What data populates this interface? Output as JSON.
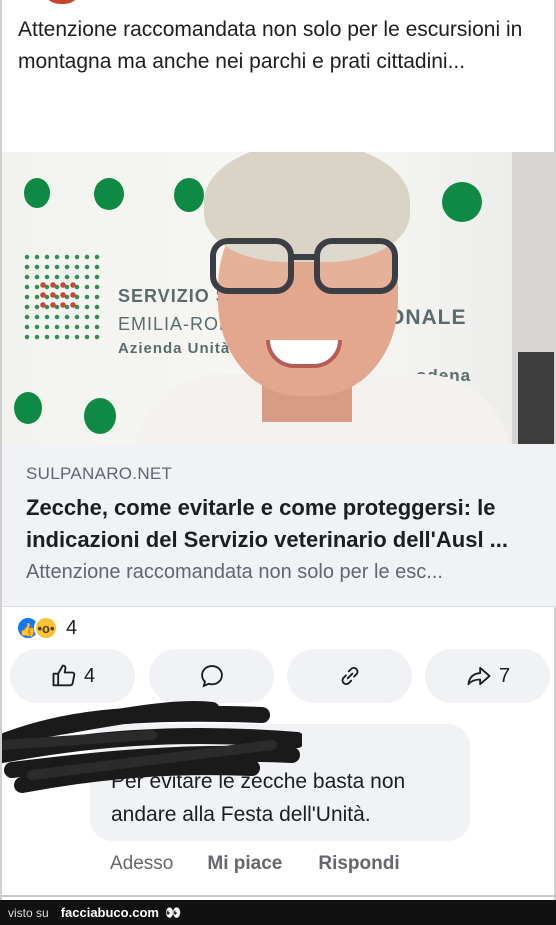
{
  "post": {
    "text": "Attenzione raccomandata non solo per le escursioni in montagna ma anche nei parchi e prati cittadini..."
  },
  "link_preview": {
    "image_sign": {
      "line1": "SERVIZIO S",
      "line1b": "ONALE",
      "line2": "EMILIA-ROM",
      "line3": "Azienda Unità S",
      "line3b": "odena"
    },
    "domain": "SULPANARO.NET",
    "title": "Zecche, come evitarle e come proteggersi: le indicazioni del Servizio veterinario dell'Ausl ...",
    "description": "Attenzione raccomandata non solo per le esc..."
  },
  "reactions": {
    "icons": [
      "like-icon",
      "wow-icon"
    ],
    "count": "4"
  },
  "actions": {
    "like": {
      "icon": "thumbs-up-icon",
      "count": "4"
    },
    "comment": {
      "icon": "comment-bubble-icon"
    },
    "share_link": {
      "icon": "link-icon"
    },
    "share": {
      "icon": "share-arrow-icon",
      "count": "7"
    }
  },
  "comment": {
    "text": "Per evitare le zecche basta non andare alla Festa dell'Unità.",
    "time": "Adesso",
    "like_label": "Mi piace",
    "reply_label": "Rispondi"
  },
  "watermark": {
    "label": "visto su",
    "site": "facciabuco.com",
    "eyes": "👀"
  },
  "colors": {
    "accent": "#1877f2",
    "button_bg": "#f0f2f5",
    "sign_green": "#0f8a45"
  }
}
